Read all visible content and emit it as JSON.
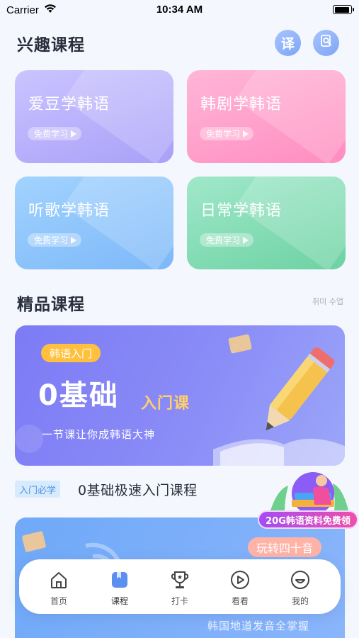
{
  "status": {
    "carrier": "Carrier",
    "time": "10:34 AM"
  },
  "header": {
    "title": "兴趣课程",
    "translate_icon_label": "译",
    "search_icon": "search-dictionary-icon"
  },
  "interest_cards": [
    {
      "title": "爱豆学韩语",
      "pill": "免费学习",
      "color_top": "#c9c2ff",
      "color_bottom": "#a9a1f8"
    },
    {
      "title": "韩剧学韩语",
      "pill": "免费学习",
      "color_top": "#ffb3d6",
      "color_bottom": "#ff8ec1"
    },
    {
      "title": "听歌学韩语",
      "pill": "免费学习",
      "color_top": "#9cd0ff",
      "color_bottom": "#7fbaf8"
    },
    {
      "title": "日常学韩语",
      "pill": "免费学习",
      "color_top": "#9de7c6",
      "color_bottom": "#6fd3a5"
    }
  ],
  "premium": {
    "title": "精品课程",
    "more": "취미 수업"
  },
  "banner": {
    "tag": "韩语入门",
    "big_text": "0基础",
    "big_sub": "入门课",
    "desc": "一节课让你成韩语大神"
  },
  "course_row": {
    "tag": "入门必学",
    "title": "0基础极速入门课程"
  },
  "promo": {
    "label": "20G韩语资料免费领"
  },
  "banner2": {
    "pill": "玩转四十音",
    "sub": "韩国地道发音全掌握"
  },
  "tabs": [
    {
      "label": "首页",
      "icon": "home-icon"
    },
    {
      "label": "课程",
      "icon": "course-book-icon"
    },
    {
      "label": "打卡",
      "icon": "trophy-icon"
    },
    {
      "label": "看看",
      "icon": "play-icon"
    },
    {
      "label": "我的",
      "icon": "smile-face-icon"
    }
  ],
  "accent": "#5b8ff0"
}
